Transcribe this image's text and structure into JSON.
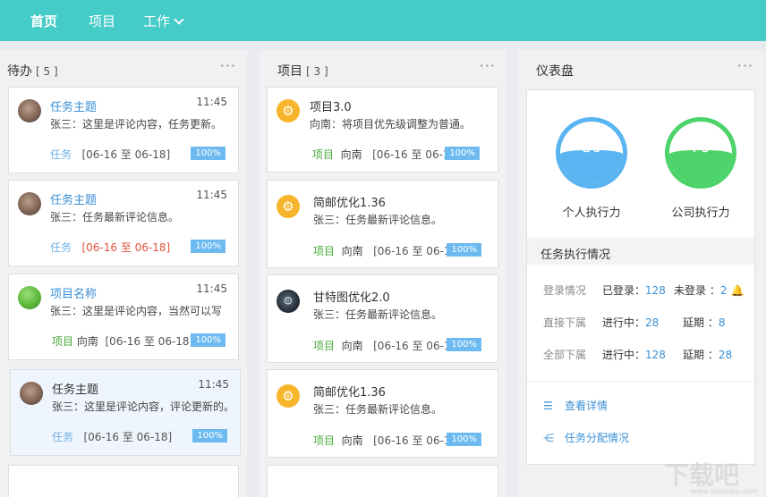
{
  "nav": {
    "items": [
      "首页",
      "项目",
      "工作"
    ]
  },
  "todo": {
    "title": "待办",
    "count": "[ 5 ]",
    "more": "···",
    "cards": [
      {
        "title": "任务主题",
        "time": "11:45",
        "message": "张三：这里是评论内容，任务更新。",
        "tag": "任务",
        "owner": "",
        "dates": "[06-16 至 06-18]",
        "progress": "100%"
      },
      {
        "title": "任务主题",
        "time": "11:45",
        "message": "张三：任务最新评论信息。",
        "tag": "任务",
        "owner": "",
        "dates": "[06-16 至 06-18]",
        "progress": "100%"
      },
      {
        "title": "项目名称",
        "time": "11:45",
        "message": "张三：这里是评论内容，当然可以写",
        "tag": "项目",
        "owner": "向南",
        "dates": "[06-16 至 06-18]",
        "progress": "100%"
      },
      {
        "title": "任务主题",
        "time": "11:45",
        "message": "张三：这里是评论内容，评论更新的。",
        "tag": "任务",
        "owner": "",
        "dates": "[06-16 至 06-18]",
        "progress": "100%"
      }
    ]
  },
  "projects": {
    "title": "项目",
    "count": "[ 3 ]",
    "more": "···",
    "cards": [
      {
        "title": "项目3.0",
        "message": "向南：将项目优先级调整为普通。",
        "tag": "项目",
        "owner": "向南",
        "dates": "[06-16 至 06-18]",
        "progress": "100%"
      },
      {
        "title": "简邮优化1.36",
        "message": "张三：任务最新评论信息。",
        "tag": "项目",
        "owner": "向南",
        "dates": "[06-16 至 06-18]",
        "progress": "100%"
      },
      {
        "title": "甘特图优化2.0",
        "message": "张三：任务最新评论信息。",
        "tag": "项目",
        "owner": "向南",
        "dates": "[06-16 至 06-18]",
        "progress": "100%"
      },
      {
        "title": "简邮优化1.36",
        "message": "张三：任务最新评论信息。",
        "tag": "项目",
        "owner": "向南",
        "dates": "[06-16 至 06-18]",
        "progress": "100%"
      }
    ]
  },
  "dashboard": {
    "title": "仪表盘",
    "more": "···",
    "gauges": [
      {
        "value": "80",
        "label": "个人执行力",
        "level": 0.55,
        "color": "#5ab4f2"
      },
      {
        "value": "79",
        "label": "公司执行力",
        "level": 0.55,
        "color": "#4cd36a"
      }
    ],
    "section_title": "任务执行情况",
    "rows": [
      {
        "label": "登录情况",
        "k1": "已登录：",
        "v1": "128",
        "k2": "未登录 ：",
        "v2": "2"
      },
      {
        "label": "直接下属",
        "k1": "进行中：",
        "v1": "28",
        "k2": "延期 ：",
        "v2": "8"
      },
      {
        "label": "全部下属",
        "k1": "进行中：",
        "v1": "128",
        "k2": "延期 ：",
        "v2": "28"
      }
    ],
    "links": [
      "查看详情",
      "任务分配情况"
    ]
  },
  "colors": {
    "accent": "#45cbc8",
    "link": "#3a8fd6",
    "badge": "#6cbaf0",
    "overdue": "#e0523d",
    "project_tag": "#4aa93c"
  },
  "watermark": {
    "text": "下载吧",
    "url": "www.xiazaiba.com"
  }
}
